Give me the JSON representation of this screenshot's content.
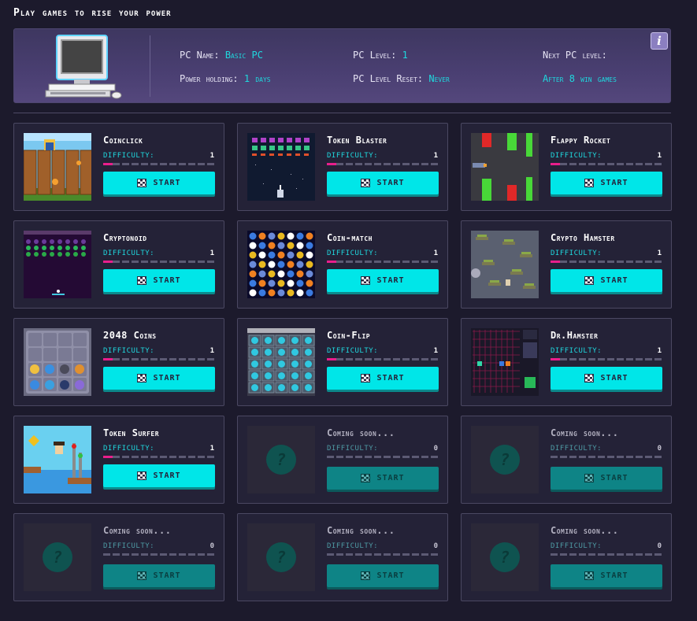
{
  "page": {
    "title": "Play games to rise your power"
  },
  "pc": {
    "name_label": "PC Name:",
    "name_value": "Basic PC",
    "level_label": "PC Level:",
    "level_value": "1",
    "next_label": "Next PC level:",
    "next_value": "After 8 win games",
    "power_label": "Power holding:",
    "power_value": "1 days",
    "reset_label": "PC Level Reset:",
    "reset_value": "Never",
    "info_label": "i"
  },
  "colors": {
    "accent": "#00e6e8",
    "difficulty": "#e91e8c",
    "background": "#1c1a2c"
  },
  "games": [
    {
      "title": "Coinclick",
      "difficulty_label": "DIFFICULTY:",
      "difficulty": "1",
      "level": 1,
      "start_label": "START",
      "thumb": "coinclick-thumbnail"
    },
    {
      "title": "Token Blaster",
      "difficulty_label": "DIFFICULTY:",
      "difficulty": "1",
      "level": 1,
      "start_label": "START",
      "thumb": "token-blaster-thumbnail"
    },
    {
      "title": "Flappy Rocket",
      "difficulty_label": "DIFFICULTY:",
      "difficulty": "1",
      "level": 1,
      "start_label": "START",
      "thumb": "flappy-rocket-thumbnail"
    },
    {
      "title": "Cryptonoid",
      "difficulty_label": "DIFFICULTY:",
      "difficulty": "1",
      "level": 1,
      "start_label": "START",
      "thumb": "cryptonoid-thumbnail"
    },
    {
      "title": "Coin-match",
      "difficulty_label": "DIFFICULTY:",
      "difficulty": "1",
      "level": 1,
      "start_label": "START",
      "thumb": "coin-match-thumbnail"
    },
    {
      "title": "Crypto Hamster",
      "difficulty_label": "DIFFICULTY:",
      "difficulty": "1",
      "level": 1,
      "start_label": "START",
      "thumb": "crypto-hamster-thumbnail"
    },
    {
      "title": "2048 Coins",
      "difficulty_label": "DIFFICULTY:",
      "difficulty": "1",
      "level": 1,
      "start_label": "START",
      "thumb": "2048-coins-thumbnail"
    },
    {
      "title": "Coin-Flip",
      "difficulty_label": "DIFFICULTY:",
      "difficulty": "1",
      "level": 1,
      "start_label": "START",
      "thumb": "coin-flip-thumbnail"
    },
    {
      "title": "Dr.Hamster",
      "difficulty_label": "DIFFICULTY:",
      "difficulty": "1",
      "level": 1,
      "start_label": "START",
      "thumb": "dr-hamster-thumbnail"
    },
    {
      "title": "Token Surfer",
      "difficulty_label": "DIFFICULTY:",
      "difficulty": "1",
      "level": 1,
      "start_label": "START",
      "thumb": "token-surfer-thumbnail"
    },
    {
      "title": "Coming soon...",
      "difficulty_label": "DIFFICULTY:",
      "difficulty": "0",
      "level": 0,
      "start_label": "START",
      "thumb": "coming-soon"
    },
    {
      "title": "Coming soon...",
      "difficulty_label": "DIFFICULTY:",
      "difficulty": "0",
      "level": 0,
      "start_label": "START",
      "thumb": "coming-soon"
    },
    {
      "title": "Coming soon...",
      "difficulty_label": "DIFFICULTY:",
      "difficulty": "0",
      "level": 0,
      "start_label": "START",
      "thumb": "coming-soon"
    },
    {
      "title": "Coming soon...",
      "difficulty_label": "DIFFICULTY:",
      "difficulty": "0",
      "level": 0,
      "start_label": "START",
      "thumb": "coming-soon"
    },
    {
      "title": "Coming soon...",
      "difficulty_label": "DIFFICULTY:",
      "difficulty": "0",
      "level": 0,
      "start_label": "START",
      "thumb": "coming-soon"
    }
  ]
}
